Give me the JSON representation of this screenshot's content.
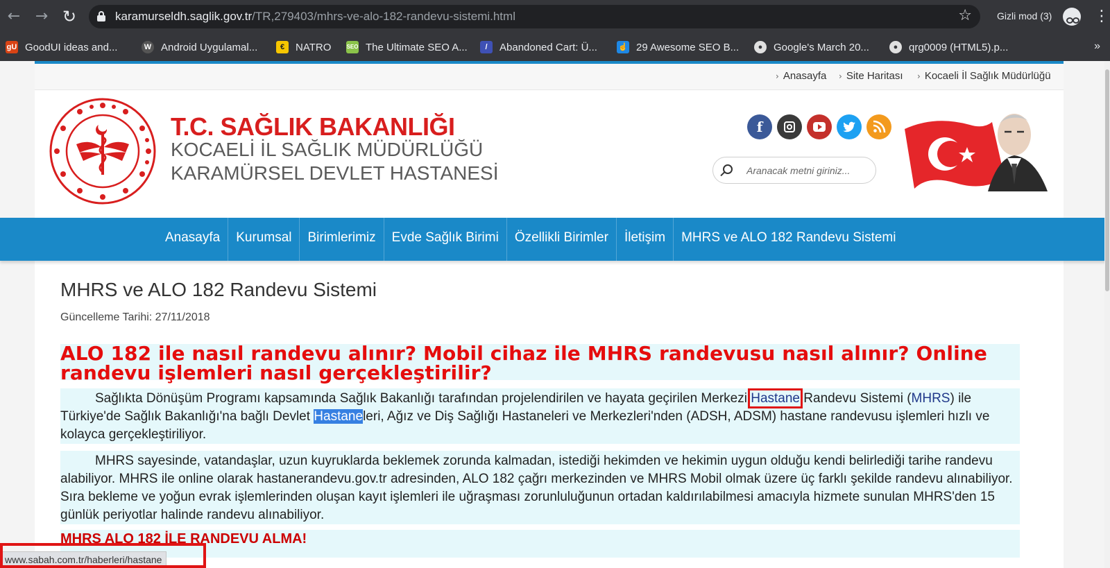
{
  "browser": {
    "url_host": "karamurseldh.saglik.gov.tr",
    "url_path": "/TR,279403/mhrs-ve-alo-182-randevu-sistemi.html",
    "incognito_label": "Gizli mod (3)",
    "bookmarks": [
      {
        "label": "GoodUI ideas and...",
        "icon": "goodui-icon",
        "color": "#d84315"
      },
      {
        "label": "Android Uygulamal...",
        "icon": "wordpress-icon",
        "color": "#555555"
      },
      {
        "label": "NATRO",
        "icon": "natro-icon",
        "color": "#f7c600"
      },
      {
        "label": "The Ultimate SEO A...",
        "icon": "seo-icon",
        "color": "#8bc34a"
      },
      {
        "label": "Abandoned Cart: Ü...",
        "icon": "cart-icon",
        "color": "#3f51b5"
      },
      {
        "label": "29 Awesome SEO B...",
        "icon": "pointer-icon",
        "color": "#1e88e5"
      },
      {
        "label": "Google's March 20...",
        "icon": "globe-icon",
        "color": "#e0e0e0"
      },
      {
        "label": "qrg0009 (HTML5).p...",
        "icon": "globe-icon",
        "color": "#e0e0e0"
      }
    ],
    "bookmarks_more": "»",
    "status_url": "www.sabah.com.tr/haberleri/hastane"
  },
  "topbar": {
    "crumbs": [
      "Anasayfa",
      "Site Haritası",
      "Kocaeli İl Sağlık Müdürlüğü"
    ]
  },
  "brand": {
    "title": "T.C. SAĞLIK BAKANLIĞI",
    "sub1": "KOCAELİ İL SAĞLIK MÜDÜRLÜĞÜ",
    "sub2": "KARAMÜRSEL DEVLET HASTANESİ",
    "accent": "#d81e1e"
  },
  "social": [
    "facebook-icon",
    "instagram-icon",
    "youtube-icon",
    "twitter-icon",
    "rss-icon"
  ],
  "search": {
    "placeholder": "Aranacak metni giriniz..."
  },
  "nav": {
    "items": [
      "Anasayfa",
      "Kurumsal",
      "Birimlerimiz",
      "Evde Sağlık Birimi",
      "Özellikli Birimler",
      "İletişim",
      "MHRS ve ALO 182 Randevu Sistemi"
    ],
    "color": "#1a89c8"
  },
  "article": {
    "title": "MHRS ve ALO 182 Randevu Sistemi",
    "updated": "Güncelleme Tarihi: 27/11/2018",
    "heading": "ALO 182 ile nasıl randevu alınır? Mobil cihaz ile MHRS randevusu nasıl alınır? Online randevu işlemleri nasıl gerçekleştirilir?",
    "p1_a": "Sağlıkta Dönüşüm Programı kapsamında Sağlık Bakanlığı tarafından projelendirilen ve hayata geçirilen Merkezi ",
    "p1_link": "Hastane",
    "p1_b": " Randevu Sistemi (",
    "p1_mhrs": "MHRS",
    "p1_c": ") ile Türkiye'de Sağlık Bakanlığı'na bağlı Devlet ",
    "p1_sel": "Hastane",
    "p1_d": "leri, Ağız ve Diş Sağlığı Hastaneleri ve Merkezleri'nden (ADSH, ADSM) hastane randevusu işlemleri hızlı ve kolayca gerçekleştiriliyor.",
    "p2": "MHRS sayesinde, vatandaşlar, uzun kuyruklarda beklemek zorunda kalmadan, istediği hekimden ve hekimin uygun olduğu kendi belirlediği tarihe randevu alabiliyor. MHRS ile online olarak hastanerandevu.gov.tr adresinden, ALO 182 çağrı merkezinden ve MHRS Mobil olmak üzere üç farklı şekilde randevu alınabiliyor. Sıra bekleme ve yoğun evrak işlemlerinden oluşan kayıt işlemleri ile uğraşması zorunluluğunun ortadan kaldırılabilmesi amacıyla hizmete sunulan MHRS'den 15 günlük periyotlar halinde randevu alınabiliyor.",
    "heading2": "MHRS ALO 182 İLE RANDEVU ALMA!"
  }
}
